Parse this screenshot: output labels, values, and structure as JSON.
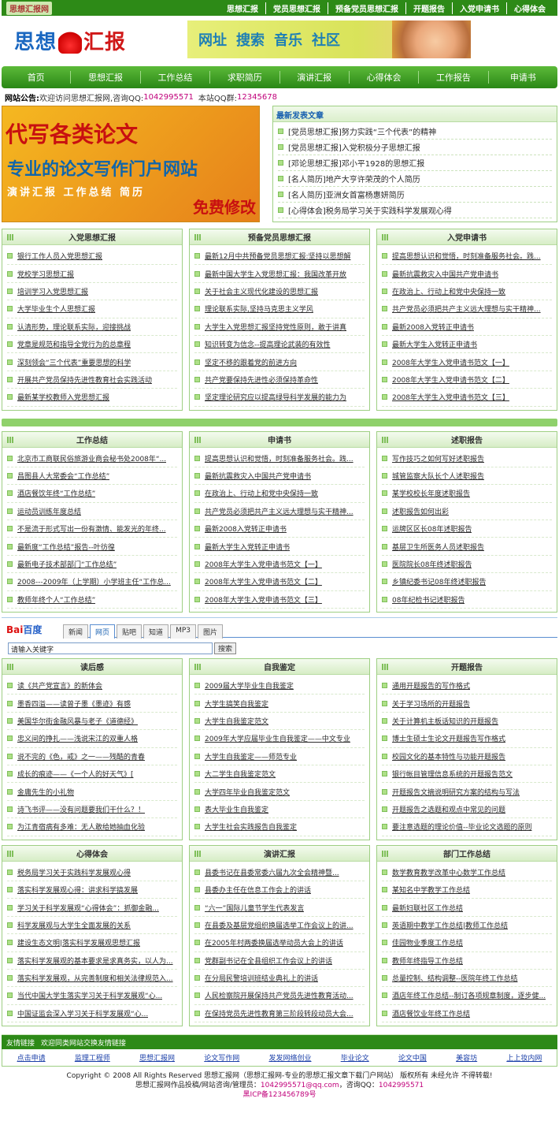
{
  "topbar": {
    "site": "思想汇报网",
    "links": [
      "思想汇报",
      "党员思想汇报",
      "预备党员思想汇报",
      "开题报告",
      "入党申请书",
      "心得体会"
    ]
  },
  "logo": {
    "left": "思想",
    "right": "汇报"
  },
  "banner": {
    "words": [
      "网址",
      "搜索",
      "音乐",
      "社区"
    ]
  },
  "nav": [
    "首页",
    "思想汇报",
    "工作总结",
    "求职简历",
    "演讲汇报",
    "心得体会",
    "工作报告",
    "申请书"
  ],
  "notice": {
    "label": "网站公告:",
    "text": "欢迎访问思想汇报网,咨询QQ:",
    "qq": "1042995571",
    "text2": "本站QQ群:",
    "group": "12345678"
  },
  "ad": {
    "line1": "代写各类论文",
    "line2": "专业的论文写作门户网站",
    "line3": "演讲汇报 工作总结 简历",
    "line4": "免费修改"
  },
  "latest": {
    "title": "最新发表文章",
    "items": [
      "[党员思想汇报]努力实践“三个代表”的精神",
      "[党员思想汇报]入党积极分子思想汇报",
      "[邓论思想汇报]邓小平1928的思想汇报",
      "[名人简历]地产大亨许荣茂的个人简历",
      "[名人简历]亚洲女首富杨惠妍简历",
      "[心得体会]税务局学习关于实践科学发展观心得"
    ]
  },
  "row1": [
    {
      "title": "入党思想汇报",
      "items": [
        "银行工作人员入党思想汇报",
        "党校学习思想汇报",
        "培训学习入党思想汇报",
        "大学毕业生个人思想汇报",
        "认清形势，理论联系实际，迎接挑战",
        "党章是规范和指导全党行为的总章程",
        "深刻领会“三个代表”重要思想的科学",
        "开展共产党员保持先进性教育社会实践活动",
        "最新某学校教师入党思想汇报"
      ]
    },
    {
      "title": "预备党员思想汇报",
      "items": [
        "最新12月中共预备党员思想汇报:坚持以思想解",
        "最新中国大学生入党思想汇报：我国改革开放",
        "关于社会主义现代化建设的思想汇报",
        "理论联系实际,坚持马克思主义学风",
        "大学生入党思想汇报坚持党性原则，敢于讲真",
        "知识转变为信念--提高理论武装的有效性",
        "坚定不移的跟着党的前进方向",
        "共产党要保持先进性必须保持革命性",
        "坚定理论研究应以提高绿导科学发展的能力为"
      ]
    },
    {
      "title": "入党申请书",
      "items": [
        "提高思想认识和觉悟，时刻准备服务社会。践...",
        "最新抗震救灾入中国共产党申请书",
        "在政治上、行动上和党中央保持一致",
        "共产党员必须把共产主义远大理想与实干精神...",
        "最新2008入党转正申请书",
        "最新大学生入党转正申请书",
        "2008年大学生入党申请书范文【一】",
        "2008年大学生入党申请书范文【二】",
        "2008年大学生入党申请书范文【三】"
      ]
    }
  ],
  "row2": [
    {
      "title": "工作总结",
      "items": [
        "北京市工商联民俗旅游业商会秘书处2008年“...",
        "昌图县人大常委会“工作总结”",
        "酒店餐饮年终“工作总结”",
        "运动员训练年度总结",
        "不是流于形式写出一份有激情、能发光的年终...",
        "最新度“工作总结”报告--叶彷徨",
        "最新电子技术部部门“工作总结”",
        "2008---2009年（上学期）小学班主任“工作总...",
        "教师年终个人“工作总结”"
      ]
    },
    {
      "title": "申请书",
      "items": [
        "提高思想认识和觉悟，时刻准备服务社会。践...",
        "最新抗震救灾入中国共产党申请书",
        "在政治上、行动上和党中央保持一致",
        "共产党员必须把共产主义远大理想与实干精神...",
        "最新2008入党转正申请书",
        "最新大学生入党转正申请书",
        "2008年大学生入党申请书范文【一】",
        "2008年大学生入党申请书范文【二】",
        "2008年大学生入党申请书范文【三】"
      ]
    },
    {
      "title": "述职报告",
      "items": [
        "写作技巧之如何写好述职报告",
        "城管监察大队长个人述职报告",
        "某学校校长年度述职报告",
        "述职报告如何出彩",
        "运牌区区长08年述职报告",
        "基层卫生所医务人员述职报告",
        "医院院长08年终述职报告",
        "乡镇纪委书记08年终述职报告",
        "08年纪检书记述职报告"
      ]
    }
  ],
  "baidu": {
    "logo_a": "Bai",
    "logo_b": "百度",
    "tabs": [
      "新闻",
      "网页",
      "贴吧",
      "知道",
      "MP3",
      "图片"
    ],
    "placeholder": "请输入关键字",
    "button": "搜索"
  },
  "row3": [
    {
      "title": "读后感",
      "items": [
        "读《共产党宣言》的新体会",
        "墨香四溢——读曾子墨《墨迹》有感",
        "美国华尔街金融风暴与老子《道德经》",
        "忠义间的挣扎——浅说宋江的双重人格",
        "说不完的《色，戒》之一——残酷的青春",
        "成长的痕迹——《一个人的好天气》[",
        "金庸先生的小礼物",
        "诗飞书评——没有问题要我们干什么？！",
        "为江青宿病有多难：无人敢给她抽血化验"
      ]
    },
    {
      "title": "自我鉴定",
      "items": [
        "2009届大学毕业生自我鉴定",
        "大学生搞笑自我鉴定",
        "大学生自我鉴定范文",
        "2009年大学应届毕业生自我鉴定——中文专业",
        "大学生自我鉴定——师范专业",
        "大二学生自我鉴定范文",
        "大学四年毕业自我鉴定范文",
        "表大毕业生自我鉴定",
        "大学生社会实践报告自我鉴定"
      ]
    },
    {
      "title": "开题报告",
      "items": [
        "通用开题报告的写作格式",
        "关于学习场所的开题报告",
        "关于计算机主板话知识的开题报告",
        "博士生硕士生论文开题报告写作格式",
        "校园文化的基本特性与功能开题报告",
        "银行帐目管理信息系统的开题报告范文",
        "开题报告文摘说明研究方案的结构与写法",
        "开题报告之选题和观点中常见的问题",
        "要注意选题的理论价值--毕业论文选题的原则"
      ]
    }
  ],
  "row4": [
    {
      "title": "心得体会",
      "items": [
        "税务局学习关于实践科学发展观心得",
        "落实科学发展观心得：讲求科学搞发展",
        "学习关于科学发展观“心得体会”：抓御金融...",
        "科学发展观与大学生全面发展的关系",
        "建设生态文明|落实科学发展观思想汇报",
        "落实科学发展观的基本要求是求真务实，以人为...",
        "落实科学发展观，从完善制度和相关法律规范入...",
        "当代中国大学生落实学习关于科学发展观“心...",
        "中国证监会深入学习关于科学发展观“心..."
      ]
    },
    {
      "title": "演讲汇报",
      "items": [
        "县委书记在县委常委六届九次全会精神暨...",
        "县委办主任在信息工作会上的讲话",
        "“六一”国际儿童节学生代表发言",
        "在县委及基层党组织换届选举工作会议上的讲...",
        "在2005年村两委换届选举动员大会上的讲话",
        "党群副书记在全县组织工作会议上的讲话",
        "在分局民警培训班结业典礼上的讲话",
        "人民检察院开展保持共产党员先进性教育活动...",
        "在保持党员先进性教育第三阶段转段动员大会..."
      ]
    },
    {
      "title": "部门工作总结",
      "items": [
        "数学教育教学改革中心数学工作总结",
        "某知名中学教学工作总结",
        "最新妇联社区工作总结",
        "英语期中教学工作总结|教师工作总结",
        "佳园物业季度工作总结",
        "教师年终指导工作总结",
        "总量控制、结构调整--医院年终工作总结",
        "酒店年终工作总结--制订各项规章制度，逐步健...",
        "酒店餐饮业年终工作总结"
      ]
    }
  ],
  "links": {
    "label": "友情链接",
    "text": "欢迎同类网站交换友情链接",
    "items": [
      "点击申请",
      "监理工程师",
      "思想汇报网",
      "论文写作网",
      "发发网络创业",
      "毕业论文",
      "论文中国",
      "美容坊",
      "上上妆内网"
    ]
  },
  "footer": {
    "line1a": "Copyright © 2008 All Rights Reserved  思想汇报网（思想汇报网-专业的思想汇报文章下载门户网站） 版权所有 未经允许 不得转载!",
    "line2a": "思想汇报网作品投稿/网站咨询/管理员：",
    "email": "1042995571@qq.com",
    "line2b": "，咨询QQ：",
    "qq": "1042995571",
    "icp": "黑ICP备123456789号"
  }
}
